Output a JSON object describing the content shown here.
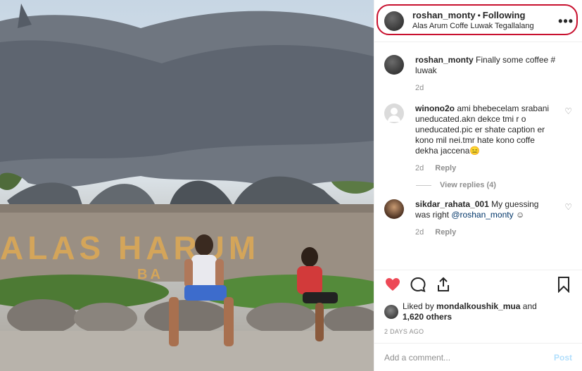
{
  "post": {
    "username": "roshan_monty",
    "follow_status": "Following",
    "location": "Alas Arum Coffe Luwak Tegallalang",
    "sign_text": "ALAS HARUM",
    "sign_sub": "BA"
  },
  "comments": [
    {
      "user": "roshan_monty",
      "text": "Finally some coffee # luwak",
      "time": "2d"
    },
    {
      "user": "winono2o",
      "text": "ami bhebecelam srabani uneducated.akn dekce tmi r o uneducated.pic er shate caption er kono mil nei.tmr hate kono coffe dekha jaccena😑",
      "time": "2d",
      "reply": "Reply"
    },
    {
      "user": "sikdar_rahata_001",
      "text_pre": "My guessing was right",
      "mention": "@roshan_monty",
      "text_post": "☺",
      "time": "2d",
      "reply": "Reply"
    }
  ],
  "view_replies": "View replies (4)",
  "likes": {
    "prefix": "Liked by",
    "user": "mondalkoushik_mua",
    "and": "and",
    "count": "1,620 others"
  },
  "time_ago": "2 DAYS AGO",
  "add_comment": {
    "placeholder": "Add a comment...",
    "post": "Post"
  },
  "colors": {
    "highlight": "#c8102e",
    "heart": "#ed4956",
    "post_button": "#b2dffc"
  }
}
